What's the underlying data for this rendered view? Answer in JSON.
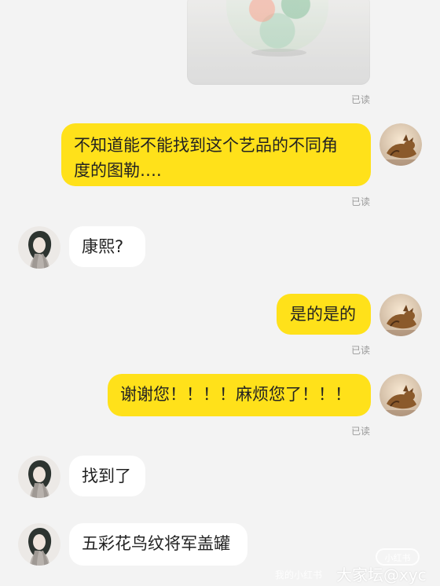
{
  "colors": {
    "background": "#f3f3f3",
    "my_bubble": "#ffe11a",
    "other_bubble": "#ffffff",
    "read_text": "#9a9a9a"
  },
  "messages": [
    {
      "id": "msg-image",
      "type": "image",
      "read_status": "已读"
    },
    {
      "id": "msg-1",
      "sender": "me",
      "text": "不知道能不能找到这个艺品的不同角度的图勒….",
      "line1": "不知道能不能找到这个艺品的不同角",
      "line2": "度的图勒….",
      "read_status": "已读"
    },
    {
      "id": "msg-2",
      "sender": "other",
      "text": "康熙?"
    },
    {
      "id": "msg-3",
      "sender": "me",
      "text": "是的是的",
      "read_status": "已读"
    },
    {
      "id": "msg-4",
      "sender": "me",
      "text": "谢谢您！！！！麻烦您了！！！",
      "read_status": "已读"
    },
    {
      "id": "msg-5",
      "sender": "other",
      "text": "找到了"
    },
    {
      "id": "msg-6",
      "sender": "other",
      "text": "五彩花鸟纹将军盖罐"
    }
  ],
  "watermark": {
    "badge": "小红书",
    "small_text": "我的小红书",
    "main_text": "大家坛@xyc"
  },
  "icons": {
    "my_avatar": "cat-avatar-icon",
    "other_avatar": "woman-avatar-icon"
  }
}
